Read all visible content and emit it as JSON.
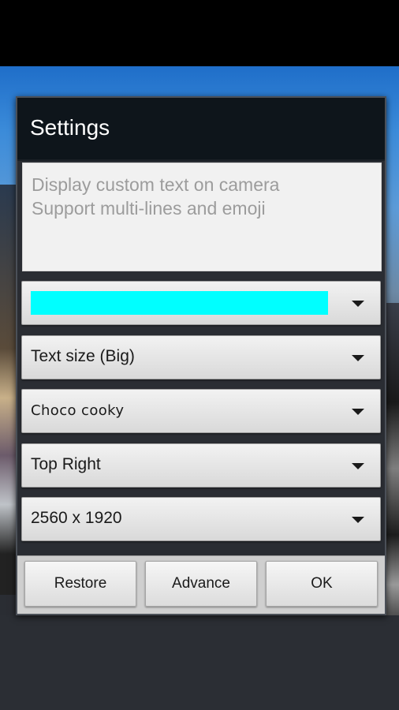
{
  "dialog": {
    "title": "Settings",
    "text_input": {
      "placeholder": "Display custom text on camera\nSupport multi-lines and emoji",
      "value": ""
    },
    "color_spinner": {
      "selected_color": "#00ffff",
      "icon": "chevron-down-icon"
    },
    "text_size_spinner": {
      "selected": "Text size (Big)"
    },
    "font_spinner": {
      "selected": "Choco cooky"
    },
    "position_spinner": {
      "selected": "Top Right"
    },
    "resolution_spinner": {
      "selected": "2560 x 1920"
    },
    "buttons": {
      "restore": "Restore",
      "advance": "Advance",
      "ok": "OK"
    }
  }
}
